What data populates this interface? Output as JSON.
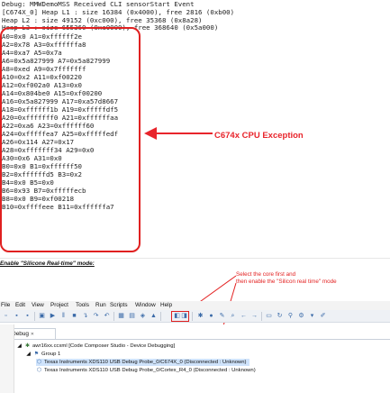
{
  "console": {
    "lines": [
      "Debug: MMWDemoMSS Received CLI sensorStart Event",
      "[C674X_0] Heap L1 : size 16384 (0x4000), free 2816 (0xb00)",
      "Heap L2 : size 49152 (0xc000), free 35368 (0x8a28)",
      "Heap L3 : size 655360 (0xa0000), free 368640 (0x5a000)",
      "A0=0x0 A1=0xffffff2e",
      "A2=0x78 A3=0xffffffa8",
      "A4=0xa7 A5=0x7a",
      "A6=0x5a827999 A7=0x5a827999",
      "A8=0xed A9=0x7fffffff",
      "A10=0x2 A11=0xf00220",
      "A12=0xf002a0 A13=0x0",
      "A14=0x804be0 A15=0xf00200",
      "A16=0x5a827999 A17=0xa57d8667",
      "A18=0xffffff1b A19=0xfffffdf5",
      "A20=0xfffffff0 A21=0xffffffaa",
      "A22=0xa6 A23=0xffffff60",
      "A24=0xfffffea7 A25=0xfffffedf",
      "A26=0x114 A27=0x17",
      "A28=0xfffffff34 A29=0x0",
      "A30=0x6 A31=0x0",
      "B0=0x0 B1=0xffffff50",
      "B2=0xffffffd5 B3=0x2",
      "B4=0x0 B5=0x0",
      "B6=0x93 B7=0xfffffecb",
      "B8=0x0 B9=0xf00218",
      "B10=0xffffeee B11=0xffffffa7"
    ]
  },
  "annotations": {
    "exception_label": "C674x CPU Exception",
    "section_title": "Enable \"Silicone Real-time\" mode:",
    "callout_line1": "Select the core first and",
    "callout_line2": "then enable the \"Silicon real time\" mode"
  },
  "menu": {
    "items": [
      "File",
      "Edit",
      "View",
      "Project",
      "Tools",
      "Run",
      "Scripts",
      "Window",
      "Help"
    ]
  },
  "debug": {
    "tab_label": "Debug",
    "tab_suffix": "✕",
    "root": "awr16xx.ccxml [Code Composer Studio - Device Debugging]",
    "group": "Group 1",
    "cores": [
      "Texas Instruments XDS110 USB Debug Probe_0/C674X_0 (Disconnected : Unknown)",
      "Texas Instruments XDS110 USB Debug Probe_0/Cortex_R4_0 (Disconnected : Unknown)"
    ]
  },
  "colors": {
    "accent_red": "#e02020",
    "selection": "#cfe3fb"
  }
}
